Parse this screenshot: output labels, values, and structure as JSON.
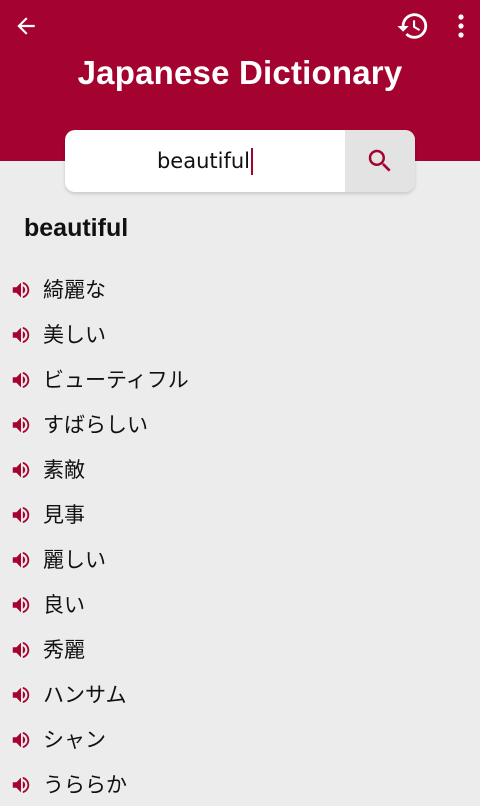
{
  "app": {
    "title": "Japanese Dictionary",
    "accent_color": "#a5032f"
  },
  "toolbar": {
    "back_icon": "arrow-left-icon",
    "history_icon": "history-icon",
    "menu_icon": "more-vert-icon"
  },
  "search": {
    "value": "beautiful",
    "button_icon": "search-icon"
  },
  "result": {
    "word": "beautiful",
    "speaker_icon": "volume-icon",
    "translations": [
      {
        "text": "綺麗な"
      },
      {
        "text": "美しい"
      },
      {
        "text": "ビューティフル"
      },
      {
        "text": "すばらしい"
      },
      {
        "text": "素敵"
      },
      {
        "text": "見事"
      },
      {
        "text": "麗しい"
      },
      {
        "text": "良い"
      },
      {
        "text": "秀麗"
      },
      {
        "text": "ハンサム"
      },
      {
        "text": "シャン"
      },
      {
        "text": "うららか"
      }
    ]
  }
}
